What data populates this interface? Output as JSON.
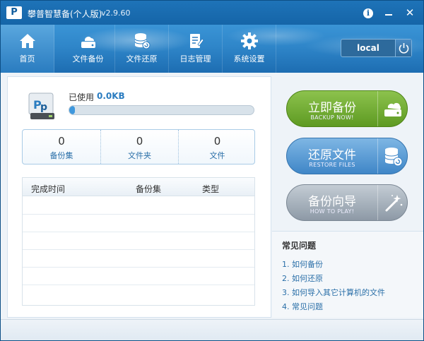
{
  "titlebar": {
    "logo_text": "P",
    "title": "攀普智慧备(个人版)",
    "version": "v2.9.60",
    "close_label": "✕"
  },
  "nav": {
    "items": [
      {
        "label": "首页",
        "icon": "home-icon"
      },
      {
        "label": "文件备份",
        "icon": "file-backup-icon"
      },
      {
        "label": "文件还原",
        "icon": "database-restore-icon"
      },
      {
        "label": "日志管理",
        "icon": "log-document-icon"
      },
      {
        "label": "系统设置",
        "icon": "gear-icon"
      }
    ],
    "active_index": 0,
    "server_label": "local"
  },
  "storage": {
    "used_label": "已使用",
    "used_value": "0.0KB",
    "progress_fraction": 0.03
  },
  "stats": [
    {
      "value": "0",
      "label": "备份集"
    },
    {
      "value": "0",
      "label": "文件夹"
    },
    {
      "value": "0",
      "label": "文件"
    }
  ],
  "table": {
    "columns": [
      "完成时间",
      "备份集",
      "类型"
    ],
    "rows": []
  },
  "actions": {
    "backup": {
      "label": "立即备份",
      "sub": "BACKUP NOW!",
      "icon": "cloud-drive-icon",
      "color": "#6fa92f"
    },
    "restore": {
      "label": "还原文件",
      "sub": "RESTORE FILES",
      "icon": "database-restore-icon",
      "color": "#4a90d0"
    },
    "guide": {
      "label": "备份向导",
      "sub": "HOW TO PLAY!",
      "icon": "magic-wand-icon",
      "color": "#9aa6b2"
    }
  },
  "faq": {
    "title": "常见问题",
    "links": [
      "1. 如何备份",
      "2. 如何还原",
      "3. 如何导入其它计算机的文件",
      "4. 常见问题"
    ]
  }
}
